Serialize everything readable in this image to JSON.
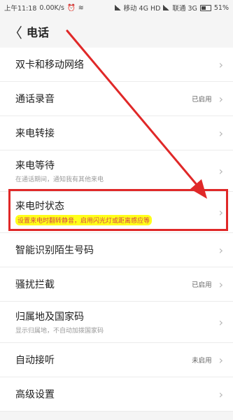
{
  "statusbar": {
    "time": "上午11:18",
    "speed": "0.00K/s",
    "carrier1": "移动 4G HD",
    "carrier2": "联通 3G",
    "battery": "51%"
  },
  "header": {
    "title": "电话"
  },
  "items": [
    {
      "label": "双卡和移动网络",
      "sub": "",
      "value": ""
    },
    {
      "label": "通话录音",
      "sub": "",
      "value": "已启用"
    },
    {
      "label": "来电转接",
      "sub": "",
      "value": ""
    },
    {
      "label": "来电等待",
      "sub": "在通话期间，通知我有其他来电",
      "value": ""
    },
    {
      "label": "来电时状态",
      "sub": "设置来电时翻转静音，启用闪光灯或距离感应等",
      "value": ""
    },
    {
      "label": "智能识别陌生号码",
      "sub": "",
      "value": ""
    },
    {
      "label": "骚扰拦截",
      "sub": "",
      "value": "已启用"
    },
    {
      "label": "归属地及国家码",
      "sub": "显示归属地，不自动加拨国家码",
      "value": ""
    },
    {
      "label": "自动接听",
      "sub": "",
      "value": "未启用"
    },
    {
      "label": "高级设置",
      "sub": "",
      "value": ""
    }
  ],
  "colors": {
    "annotation": "#e02828",
    "highlighter": "#ffff1a"
  }
}
